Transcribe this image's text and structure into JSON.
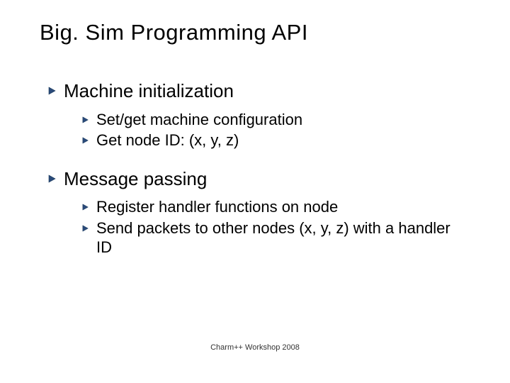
{
  "title": "Big. Sim Programming API",
  "sections": [
    {
      "heading": "Machine initialization",
      "items": [
        "Set/get machine configuration",
        "Get node ID: (x, y, z)"
      ]
    },
    {
      "heading": "Message passing",
      "items": [
        "Register handler functions on node",
        "Send packets to other nodes (x, y, z) with a handler ID"
      ]
    }
  ],
  "footer": "Charm++ Workshop 2008"
}
